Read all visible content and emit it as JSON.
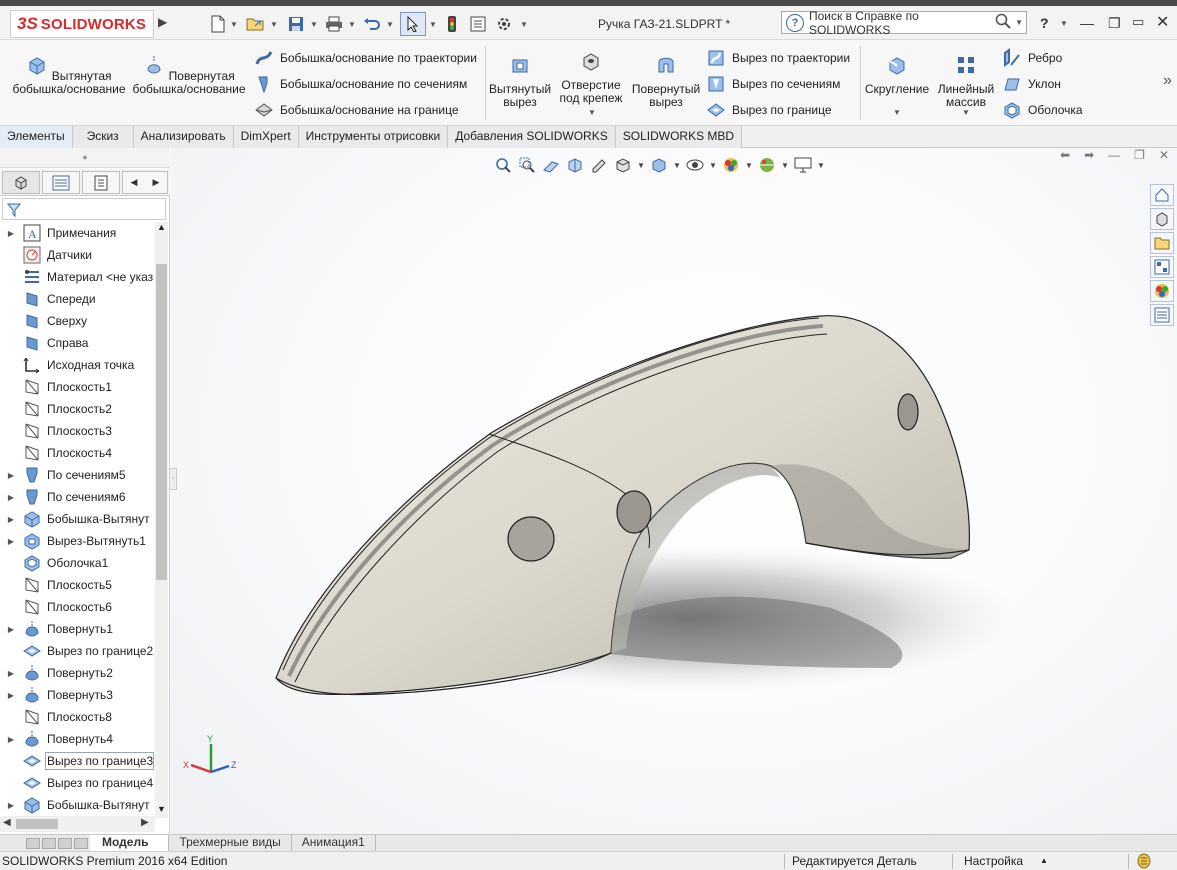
{
  "app": {
    "brand_prefix": "3S",
    "brand_name": "SOLIDWORKS",
    "document_title": "Ручка ГАЗ-21.SLDPRT *",
    "help_search_placeholder": "Поиск в Справке по SOLIDWORKS",
    "help_label": "?"
  },
  "ribbon": {
    "extruded_boss": "Вытянутая бобышка/основание",
    "revolved_boss": "Повернутая бобышка/основание",
    "swept_boss": "Бобышка/основание по траектории",
    "lofted_boss": "Бобышка/основание по сечениям",
    "boundary_boss": "Бобышка/основание на границе",
    "extruded_cut": "Вытянутый вырез",
    "hole_wizard": "Отверстие под крепеж",
    "revolved_cut": "Повернутый вырез",
    "swept_cut": "Вырез по траектории",
    "lofted_cut": "Вырез по сечениям",
    "boundary_cut": "Вырез по границе",
    "fillet": "Скругление",
    "linear_pattern": "Линейный массив",
    "rib": "Ребро",
    "draft": "Уклон",
    "shell": "Оболочка"
  },
  "tabs": [
    {
      "label": "Элементы",
      "active": true
    },
    {
      "label": "Эскиз",
      "active": false
    },
    {
      "label": "Анализировать",
      "active": false
    },
    {
      "label": "DimXpert",
      "active": false
    },
    {
      "label": "Инструменты отрисовки",
      "active": false
    },
    {
      "label": "Добавления SOLIDWORKS",
      "active": false
    },
    {
      "label": "SOLIDWORKS MBD",
      "active": false
    }
  ],
  "feature_tree": [
    {
      "label": "Примечания",
      "icon": "annotations-icon",
      "expandable": true
    },
    {
      "label": "Датчики",
      "icon": "sensors-icon",
      "expandable": false
    },
    {
      "label": "Материал <не указ",
      "icon": "material-icon",
      "expandable": false
    },
    {
      "label": "Спереди",
      "icon": "plane-icon",
      "expandable": false
    },
    {
      "label": "Сверху",
      "icon": "plane-icon",
      "expandable": false
    },
    {
      "label": "Справа",
      "icon": "plane-icon",
      "expandable": false
    },
    {
      "label": "Исходная точка",
      "icon": "origin-icon",
      "expandable": false
    },
    {
      "label": "Плоскость1",
      "icon": "ref-plane-icon",
      "expandable": false
    },
    {
      "label": "Плоскость2",
      "icon": "ref-plane-icon",
      "expandable": false
    },
    {
      "label": "Плоскость3",
      "icon": "ref-plane-icon",
      "expandable": false
    },
    {
      "label": "Плоскость4",
      "icon": "ref-plane-icon",
      "expandable": false
    },
    {
      "label": "По сечениям5",
      "icon": "loft-icon",
      "expandable": true
    },
    {
      "label": "По сечениям6",
      "icon": "loft-icon",
      "expandable": true
    },
    {
      "label": "Бобышка-Вытянут",
      "icon": "extrude-icon",
      "expandable": true
    },
    {
      "label": "Вырез-Вытянуть1",
      "icon": "cut-extrude-icon",
      "expandable": true
    },
    {
      "label": "Оболочка1",
      "icon": "shell-icon",
      "expandable": false
    },
    {
      "label": "Плоскость5",
      "icon": "ref-plane-icon",
      "expandable": false
    },
    {
      "label": "Плоскость6",
      "icon": "ref-plane-icon",
      "expandable": false
    },
    {
      "label": "Повернуть1",
      "icon": "revolve-icon",
      "expandable": true
    },
    {
      "label": "Вырез по границе2",
      "icon": "boundary-cut-icon",
      "expandable": false
    },
    {
      "label": "Повернуть2",
      "icon": "revolve-icon",
      "expandable": true
    },
    {
      "label": "Повернуть3",
      "icon": "revolve-icon",
      "expandable": true
    },
    {
      "label": "Плоскость8",
      "icon": "ref-plane-icon",
      "expandable": false
    },
    {
      "label": "Повернуть4",
      "icon": "revolve-icon",
      "expandable": true
    },
    {
      "label": "Вырез по границе3",
      "icon": "boundary-cut-icon",
      "expandable": false,
      "selected": true
    },
    {
      "label": "Вырез по границе4",
      "icon": "boundary-cut-icon",
      "expandable": false
    },
    {
      "label": "Бобышка-Вытянут",
      "icon": "extrude-icon",
      "expandable": true
    }
  ],
  "bottom_tabs": [
    {
      "label": "Модель",
      "active": true
    },
    {
      "label": "Трехмерные виды",
      "active": false
    },
    {
      "label": "Анимация1",
      "active": false
    }
  ],
  "status": {
    "edition": "SOLIDWORKS Premium 2016 x64 Edition",
    "mode": "Редактируется Деталь",
    "units": "Настройка"
  },
  "colors": {
    "brand_red": "#d92b2b",
    "icon_blue": "#3d6aa6",
    "model_body": "#dcd8cd",
    "selected_outline": "#9aa5b6"
  },
  "triad": {
    "x": "X",
    "y": "Y",
    "z": "Z"
  }
}
